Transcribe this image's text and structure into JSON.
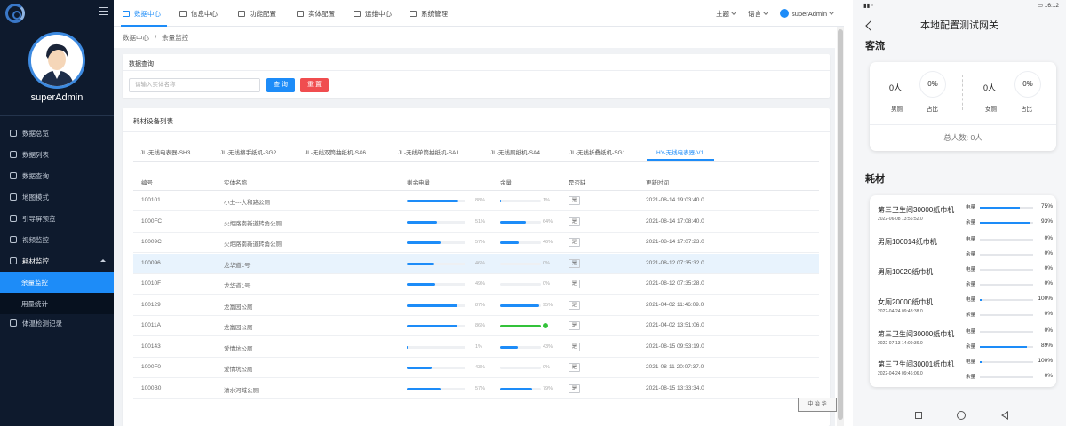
{
  "user": {
    "name": "superAdmin"
  },
  "sidebar": {
    "items": [
      {
        "label": "数据总览",
        "icon": "dashboard-icon"
      },
      {
        "label": "数据列表",
        "icon": "list-icon"
      },
      {
        "label": "数据查询",
        "icon": "search-icon"
      },
      {
        "label": "地图模式",
        "icon": "map-icon"
      },
      {
        "label": "引导屏预览",
        "icon": "monitor-icon"
      },
      {
        "label": "视频监控",
        "icon": "video-icon"
      },
      {
        "label": "耗材监控",
        "icon": "supplies-icon"
      },
      {
        "label": "余量监控"
      },
      {
        "label": "用量统计"
      },
      {
        "label": "体温检测记录",
        "icon": "thermometer-icon"
      }
    ]
  },
  "topnav": {
    "tabs": [
      "数据中心",
      "信息中心",
      "功能配置",
      "实体配置",
      "运维中心",
      "系统管理"
    ],
    "theme": "主题",
    "language": "语言",
    "user": "superAdmin"
  },
  "breadcrumb": {
    "root": "数据中心",
    "sep": "/",
    "current": "余量监控"
  },
  "query": {
    "title": "数据查询",
    "placeholder": "请输入实体名称",
    "search_label": "查 询",
    "reset_label": "重 置"
  },
  "list": {
    "title": "耗材设备列表",
    "device_tabs": [
      "JL-无线电表器-SH3",
      "JL-无线擦手纸机-SG2",
      "JL-无线双筒抽纸机-SA6",
      "JL-无线单筒抽纸机-SA1",
      "JL-无线厕纸机-SA4",
      "JL-无线折叠纸机-SG1",
      "HY-无线电表器-V1"
    ],
    "columns": [
      "编号",
      "实体名称",
      "剩余电量",
      "余量",
      "是否缺",
      "更新时间"
    ],
    "rows": [
      {
        "id": "100101",
        "name": "小土---大和路公厕",
        "battery": 88,
        "remain": 1,
        "missing": "是",
        "time": "2021-08-14 19:03:40.0"
      },
      {
        "id": "1000FC",
        "name": "火炬路南新道转角公厕",
        "battery": 51,
        "remain": 64,
        "missing": "是",
        "time": "2021-08-14 17:08:40.0"
      },
      {
        "id": "10009C",
        "name": "火炬路南新道转角公厕",
        "battery": 57,
        "remain": 46,
        "missing": "是",
        "time": "2021-08-14 17:07:23.0"
      },
      {
        "id": "100096",
        "name": "龙华道1号",
        "battery": 46,
        "remain": 0,
        "missing": "是",
        "time": "2021-08-12 07:35:32.0"
      },
      {
        "id": "10010F",
        "name": "龙华道1号",
        "battery": 49,
        "remain": 0,
        "missing": "是",
        "time": "2021-08-12 07:35:28.0"
      },
      {
        "id": "100129",
        "name": "龙富园公厕",
        "battery": 87,
        "remain": 95,
        "missing": "是",
        "time": "2021-04-02 11:46:09.0"
      },
      {
        "id": "10011A",
        "name": "龙富园公厕",
        "battery": 86,
        "remain": 100,
        "missing": "是",
        "time": "2021-04-02 13:51:06.0"
      },
      {
        "id": "100143",
        "name": "爱情坑公厕",
        "battery": 1,
        "remain": 43,
        "missing": "是",
        "time": "2021-08-15 09:53:19.0"
      },
      {
        "id": "1000F0",
        "name": "爱情坑公厕",
        "battery": 43,
        "remain": 0,
        "missing": "是",
        "time": "2021-08-11 20:07:37.0"
      },
      {
        "id": "1000B0",
        "name": "清水河城公厕",
        "battery": 57,
        "remain": 79,
        "missing": "是",
        "time": "2021-08-15 13:33:34.0"
      }
    ]
  },
  "stamp": "中 冶 华",
  "phone": {
    "status_time": "16:12",
    "title": "本地配置测试网关",
    "flow_section": "客流",
    "male_count": "0人",
    "male_ratio": "0%",
    "female_count": "0人",
    "female_ratio": "0%",
    "male_label": "男厕",
    "female_label": "女厕",
    "ratio_label": "占比",
    "total": "总人数: 0人",
    "supplies_section": "耗材",
    "battery_label": "电量",
    "remain_label": "余量",
    "supplies": [
      {
        "name": "第三卫生间30000纸巾机",
        "date": "2022-06-08 13:56:52.0",
        "battery": "75%",
        "remain": "93%",
        "b": 75,
        "r": 93
      },
      {
        "name": "男厕100014纸巾机",
        "date": "",
        "battery": "0%",
        "remain": "0%",
        "b": 0,
        "r": 0
      },
      {
        "name": "男厕10020纸巾机",
        "date": "",
        "battery": "0%",
        "remain": "0%",
        "b": 0,
        "r": 0
      },
      {
        "name": "女厕20000纸巾机",
        "date": "2022-04-24 09:48:38.0",
        "battery": "100%",
        "remain": "0%",
        "b": 100,
        "r": 0
      },
      {
        "name": "第三卫生间30000纸巾机",
        "date": "2022-07-13 14:09:36.0",
        "battery": "0%",
        "remain": "89%",
        "b": 0,
        "r": 89
      },
      {
        "name": "第三卫生间30001纸巾机",
        "date": "2022-04-24 09:46:06.0",
        "battery": "100%",
        "remain": "0%",
        "b": 100,
        "r": 0
      }
    ]
  }
}
